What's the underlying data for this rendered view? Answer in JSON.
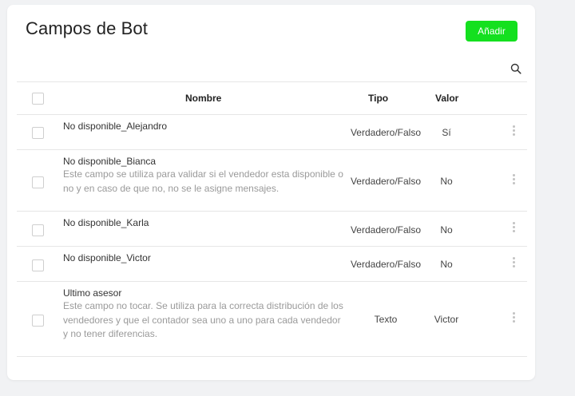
{
  "page": {
    "title": "Campos de Bot",
    "add_label": "Añadir"
  },
  "icons": {
    "search": "search-icon",
    "row_menu": "more-vertical-icon"
  },
  "colors": {
    "accent": "#14e01f"
  },
  "table": {
    "headers": {
      "name": "Nombre",
      "type": "Tipo",
      "value": "Valor"
    },
    "rows": [
      {
        "name": "No disponible_Alejandro",
        "desc": "",
        "type": "Verdadero/Falso",
        "value": "Sí"
      },
      {
        "name": "No disponible_Bianca",
        "desc": "Este campo se utiliza para validar si el vendedor esta disponible o no y en caso de que no, no se le asigne mensajes.",
        "type": "Verdadero/Falso",
        "value": "No"
      },
      {
        "name": "No disponible_Karla",
        "desc": "",
        "type": "Verdadero/Falso",
        "value": "No"
      },
      {
        "name": "No disponible_Victor",
        "desc": "",
        "type": "Verdadero/Falso",
        "value": "No"
      },
      {
        "name": "Ultimo asesor",
        "desc": "Este campo no tocar. Se utiliza para la correcta distribución de los vendedores y que el contador sea uno a uno para cada vendedor y no tener diferencias.",
        "type": "Texto",
        "value": "Victor"
      }
    ]
  }
}
